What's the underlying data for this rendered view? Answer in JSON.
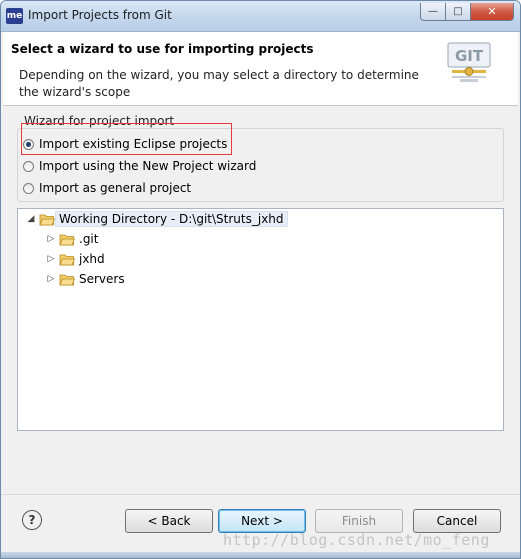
{
  "window": {
    "app_icon_text": "me",
    "title": "Import Projects from Git",
    "controls": {
      "minimize": "—",
      "maximize": "□",
      "close": "✕"
    }
  },
  "header": {
    "title": "Select a wizard to use for importing projects",
    "description": "Depending on the wizard, you may select a directory to determine the wizard's scope",
    "logo_text": "GIT"
  },
  "wizard_group": {
    "label": "Wizard for project import",
    "options": [
      {
        "label": "Import existing Eclipse projects",
        "checked": true
      },
      {
        "label": "Import using the New Project wizard",
        "checked": false
      },
      {
        "label": "Import as general project",
        "checked": false
      }
    ]
  },
  "tree": {
    "root": {
      "label": "Working Directory - D:\\git\\Struts_jxhd",
      "expanded": true
    },
    "children": [
      {
        "label": ".git"
      },
      {
        "label": "jxhd"
      },
      {
        "label": "Servers"
      }
    ]
  },
  "buttons": {
    "help": "?",
    "back": "< Back",
    "next": "Next >",
    "finish": "Finish",
    "cancel": "Cancel"
  },
  "watermark": "http://blog.csdn.net/mo_feng",
  "colors": {
    "highlight_border": "#e23b3b",
    "folder": "#e8b64c"
  }
}
